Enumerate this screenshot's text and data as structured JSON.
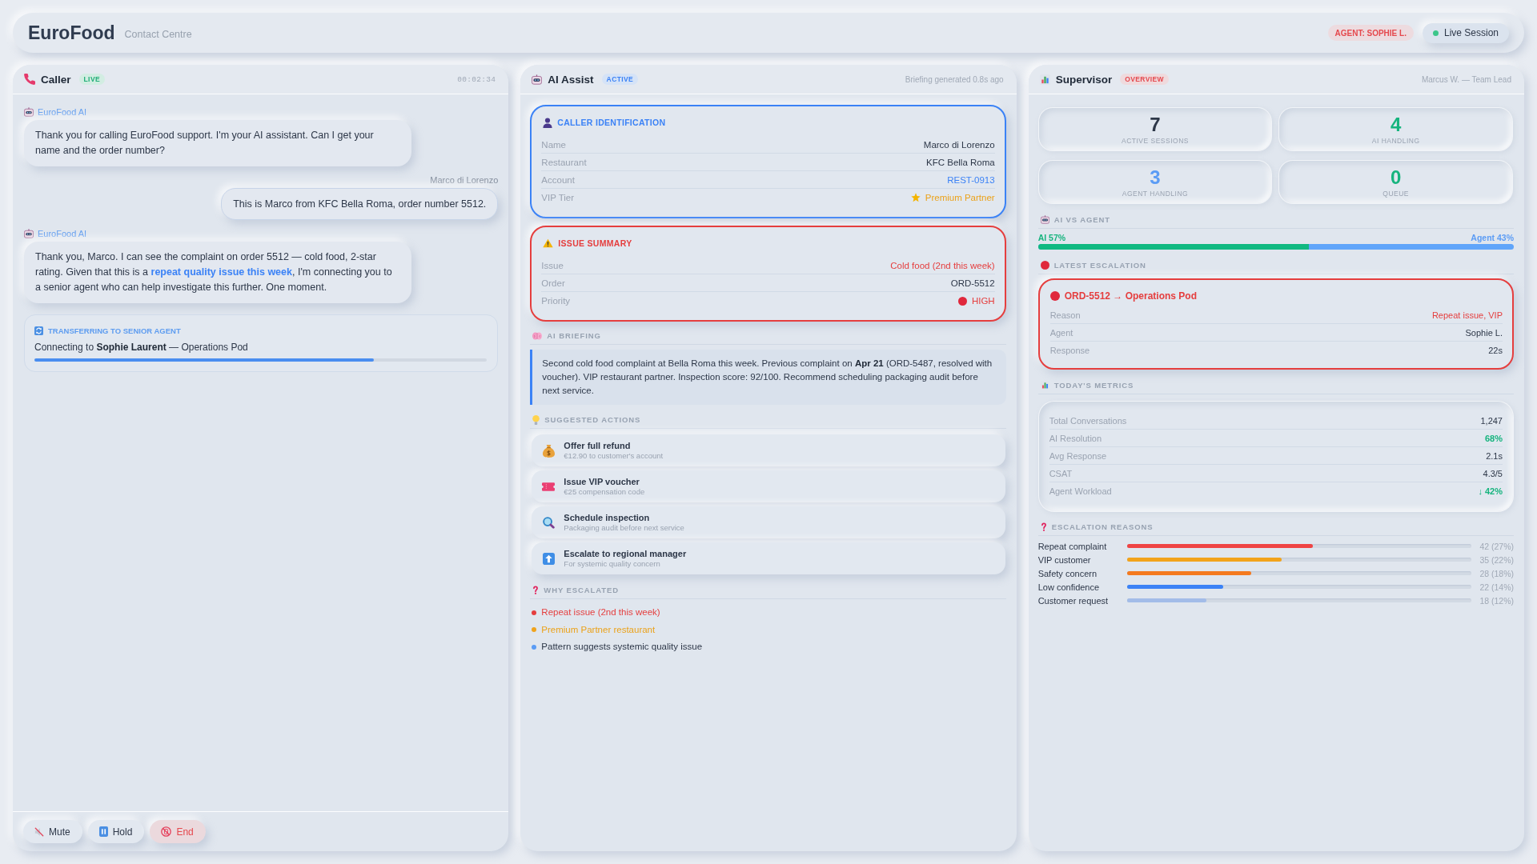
{
  "header": {
    "title": "EuroFood",
    "subtitle": "Contact Centre",
    "agent_badge": "AGENT: SOPHIE L.",
    "session": "Live Session"
  },
  "caller_panel": {
    "title": "Caller",
    "badge": "LIVE",
    "timer": "00:02:34",
    "messages": [
      {
        "kind": "ai",
        "sender": "EuroFood AI",
        "text": "Thank you for calling EuroFood support. I'm your AI assistant. Can I get your name and the order number?"
      },
      {
        "kind": "caller",
        "sender": "Marco di Lorenzo",
        "text": "This is Marco from KFC Bella Roma, order number 5512."
      },
      {
        "kind": "ai",
        "sender": "EuroFood AI",
        "text": "Thank you, Marco. I can see the complaint on order 5512 — cold food, 2-star rating. Given that this is a **repeat quality issue this week**, I'm connecting you to a senior agent who can help investigate this further. One moment."
      }
    ],
    "transfer": {
      "title": "TRANSFERRING TO SENIOR AGENT",
      "text": "Connecting to **Sophie Laurent** — Operations Pod",
      "level": 0.75
    },
    "controls": [
      {
        "kind": "mute",
        "label": "Mute"
      },
      {
        "kind": "hold",
        "label": "Hold"
      },
      {
        "kind": "end",
        "label": "End"
      }
    ]
  },
  "ai_panel": {
    "title": "AI Assist",
    "badge": "ACTIVE",
    "meta": "Briefing generated 0.8s ago",
    "cards": [
      {
        "kind": "identification",
        "title": "CALLER IDENTIFICATION",
        "rows": [
          {
            "label": "Name",
            "value": "Marco di Lorenzo",
            "kind": "plain"
          },
          {
            "label": "Restaurant",
            "value": "KFC Bella Roma",
            "kind": "plain"
          },
          {
            "label": "Account",
            "value": "REST-0913",
            "kind": "link"
          },
          {
            "label": "VIP Tier",
            "value": "Premium Partner",
            "kind": "tier"
          }
        ]
      },
      {
        "kind": "issue",
        "title": "ISSUE SUMMARY",
        "rows": [
          {
            "label": "Issue",
            "value": "Cold food (2nd this week)",
            "kind": "alert"
          },
          {
            "label": "Order",
            "value": "ORD-5512",
            "kind": "plain"
          },
          {
            "label": "Priority",
            "value": "HIGH",
            "kind": "priority"
          }
        ]
      }
    ],
    "briefing": {
      "heading": "AI BRIEFING",
      "text": "Second cold food complaint at Bella Roma this week. Previous complaint on **Apr 21** (ORD-5487, resolved with voucher). VIP restaurant partner. Inspection score: 92/100. Recommend scheduling packaging audit before next service."
    },
    "suggested_actions": {
      "heading": "SUGGESTED ACTIONS",
      "items": [
        {
          "kind": "refund",
          "title": "Offer full refund",
          "detail": "€12.90 to customer's account"
        },
        {
          "kind": "voucher",
          "title": "Issue VIP voucher",
          "detail": "€25 compensation code"
        },
        {
          "kind": "inspection",
          "title": "Schedule inspection",
          "detail": "Packaging audit before next service"
        },
        {
          "kind": "escalation",
          "title": "Escalate to regional manager",
          "detail": "For systemic quality concern"
        }
      ]
    },
    "why_escalated": {
      "heading": "WHY ESCALATED",
      "reasons": [
        {
          "kind": "critical",
          "text": "Repeat issue (2nd this week)",
          "color": "#e53e3e"
        },
        {
          "kind": "warning",
          "text": "Premium Partner restaurant",
          "color": "#f0a31c"
        },
        {
          "kind": "info",
          "text": "Pattern suggests systemic quality issue",
          "color": "#5b9cf5"
        }
      ]
    }
  },
  "supervisor_panel": {
    "title": "Supervisor",
    "badge": "OVERVIEW",
    "meta": "Marcus W. — Team Lead",
    "stats": [
      {
        "value": "7",
        "label": "ACTIVE SESSIONS",
        "kind": "neutral"
      },
      {
        "value": "4",
        "label": "AI HANDLING",
        "kind": "positive"
      },
      {
        "value": "3",
        "label": "AGENT HANDLING",
        "kind": "info"
      },
      {
        "value": "0",
        "label": "QUEUE",
        "kind": "positive"
      }
    ],
    "ai_vs_agent": {
      "heading": "AI VS AGENT",
      "ai_label": "AI 57%",
      "agent_label": "Agent 43%",
      "level": 0.57
    },
    "latest_escalation": {
      "heading": "LATEST ESCALATION",
      "title": "ORD-5512 → Operations Pod",
      "rows": [
        {
          "label": "Reason",
          "value": "Repeat issue, VIP",
          "kind": "alert"
        },
        {
          "label": "Agent",
          "value": "Sophie L.",
          "kind": "plain"
        },
        {
          "label": "Response",
          "value": "22s",
          "kind": "plain"
        }
      ]
    },
    "todays_metrics": {
      "heading": "TODAY'S METRICS",
      "rows": [
        {
          "label": "Total Conversations",
          "value": "1,247",
          "kind": "plain"
        },
        {
          "label": "AI Resolution",
          "value": "68%",
          "kind": "positive"
        },
        {
          "label": "Avg Response",
          "value": "2.1s",
          "kind": "plain"
        },
        {
          "label": "CSAT",
          "value": "4.3/5",
          "kind": "plain"
        },
        {
          "label": "Agent Workload",
          "value": "↓ 42%",
          "kind": "positive"
        }
      ]
    },
    "escalation_reasons": {
      "heading": "ESCALATION REASONS",
      "items": [
        {
          "label": "Repeat complaint",
          "reading": "42 (27%)",
          "level": 0.54,
          "color": "#ef4444"
        },
        {
          "label": "VIP customer",
          "reading": "35 (22%)",
          "level": 0.45,
          "color": "#f2a31b"
        },
        {
          "label": "Safety concern",
          "reading": "28 (18%)",
          "level": 0.36,
          "color": "#f47a1f"
        },
        {
          "label": "Low confidence",
          "reading": "22 (14%)",
          "level": 0.28,
          "color": "#3b82f6"
        },
        {
          "label": "Customer request",
          "reading": "18 (12%)",
          "level": 0.23,
          "color": "#a3bce8"
        }
      ]
    }
  }
}
